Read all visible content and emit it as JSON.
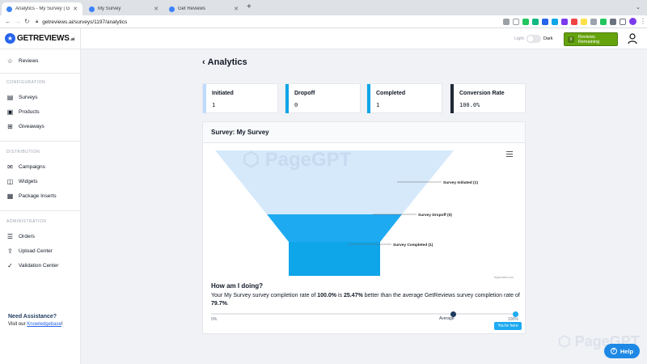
{
  "browser": {
    "tabs": [
      {
        "label": "Analytics - My Survey | GetRe",
        "active": true
      },
      {
        "label": "My Survey",
        "active": false
      },
      {
        "label": "Get Reviews",
        "active": false
      }
    ],
    "url": "getreviews.ai/surveys/1197/analytics"
  },
  "brand": {
    "name": "GETREVIEWS",
    "suffix": ".ai",
    "accent": "#2563eb"
  },
  "sidebar": {
    "top_item": {
      "label": "Reviews",
      "icon": "star-icon"
    },
    "sections": [
      {
        "heading": "CONFIGURATION",
        "items": [
          {
            "label": "Surveys",
            "icon": "clipboard-icon"
          },
          {
            "label": "Products",
            "icon": "box-icon"
          },
          {
            "label": "Giveaways",
            "icon": "gift-icon"
          }
        ]
      },
      {
        "heading": "DISTRIBUTION",
        "items": [
          {
            "label": "Campaigns",
            "icon": "mail-icon"
          },
          {
            "label": "Widgets",
            "icon": "widget-icon"
          },
          {
            "label": "Package Inserts",
            "icon": "qr-icon"
          }
        ]
      },
      {
        "heading": "ADMINISTRATION",
        "items": [
          {
            "label": "Orders",
            "icon": "list-icon"
          },
          {
            "label": "Upload Center",
            "icon": "upload-icon"
          },
          {
            "label": "Validation Center",
            "icon": "check-icon"
          }
        ]
      }
    ],
    "assistance": {
      "title": "Need Assistance?",
      "text": "Visit our",
      "link": "Knowledgebase",
      "trail": "!"
    }
  },
  "header": {
    "theme_light": "Light",
    "theme_dark": "Dark",
    "reviews_count": "9",
    "reviews_label": "Reviews Remaining",
    "reviews_color": "#65a30d"
  },
  "page": {
    "title": "Analytics"
  },
  "stats": [
    {
      "label": "Initiated",
      "value": "1",
      "color": "#bfdbfe"
    },
    {
      "label": "Dropoff",
      "value": "0",
      "color": "#0ea5e9"
    },
    {
      "label": "Completed",
      "value": "1",
      "color": "#0ea5e9"
    },
    {
      "label": "Conversion Rate",
      "value": "100.0%",
      "color": "#1f2937"
    }
  ],
  "card": {
    "title": "Survey: My Survey"
  },
  "chart_data": {
    "type": "funnel",
    "stages": [
      {
        "name": "Survey Initiated",
        "value": 1,
        "label": "Survey Initiated (1)",
        "color": "#d6e9fb"
      },
      {
        "name": "Survey Dropoff",
        "value": 0,
        "label": "Survey Dropoff (0)",
        "color": "#1eaaf1"
      },
      {
        "name": "Survey Completed",
        "value": 1,
        "label": "Survey Completed (1)",
        "color": "#0ea5e9"
      }
    ],
    "credit": "Highcharts.com"
  },
  "performance": {
    "heading": "How am I doing?",
    "text_1": "Your My Survey survey completion rate of ",
    "rate": "100.0%",
    "text_2": " is ",
    "diff": "25.47%",
    "text_3": " better than the average GetReviews survey completion rate of ",
    "avg": "79.7%",
    "text_4": ".",
    "tick_0": "0%",
    "tick_avg": "Average",
    "tick_100": "100%",
    "avg_value": 79.7,
    "you_value": 100,
    "you_label": "You're here"
  },
  "help": {
    "label": "Help"
  }
}
